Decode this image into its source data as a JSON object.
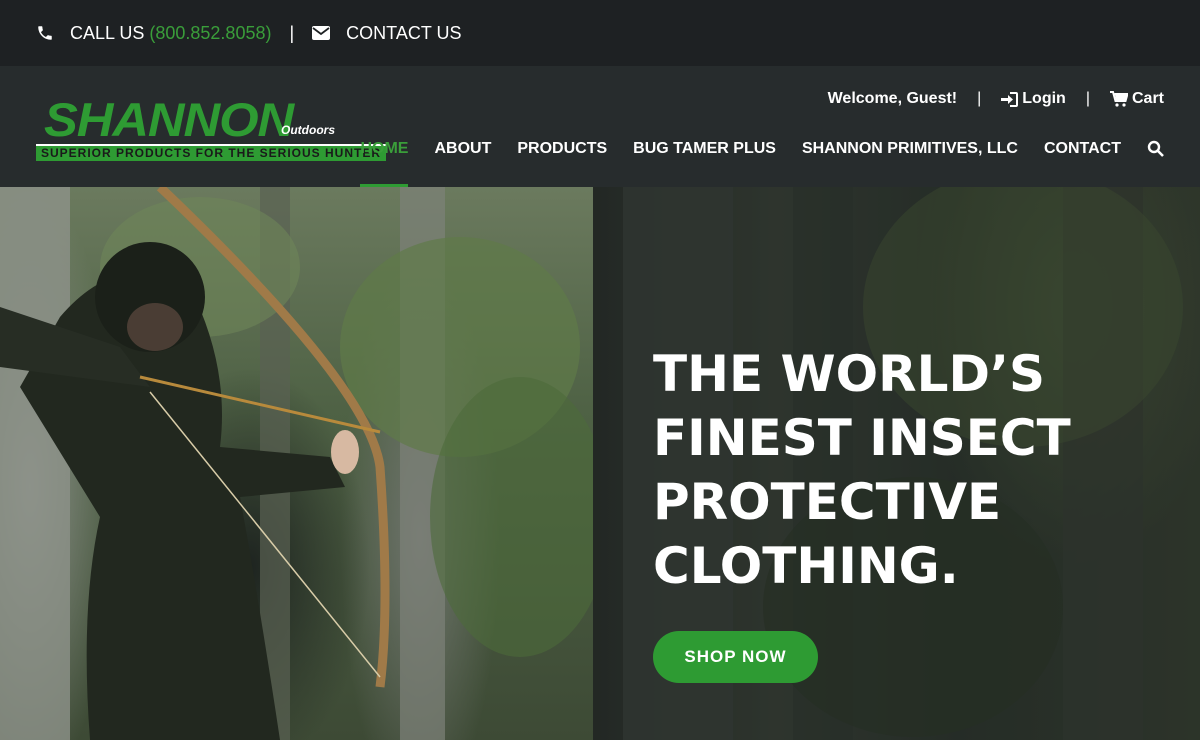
{
  "topbar": {
    "call_label": "CALL US",
    "phone": "(800.852.8058)",
    "separator": "|",
    "contact_label": "CONTACT US"
  },
  "logo": {
    "name": "SHANNON",
    "sub": "Outdoors",
    "tagline": "SUPERIOR PRODUCTS FOR THE SERIOUS HUNTER"
  },
  "account": {
    "welcome": "Welcome, Guest!",
    "separator": "|",
    "login": "Login",
    "cart": "Cart"
  },
  "nav": {
    "items": [
      {
        "label": "HOME",
        "active": true
      },
      {
        "label": "ABOUT"
      },
      {
        "label": "PRODUCTS"
      },
      {
        "label": "BUG TAMER PLUS"
      },
      {
        "label": "SHANNON PRIMITIVES, LLC"
      },
      {
        "label": "CONTACT"
      }
    ]
  },
  "hero": {
    "headline_lines": [
      "THE WORLD’S",
      "FINEST INSECT",
      "PROTECTIVE",
      "CLOTHING."
    ],
    "cta": "SHOP NOW"
  },
  "colors": {
    "accent": "#2e9b33",
    "topbar_bg": "#1e2123",
    "header_bg": "#272c2d"
  },
  "icons": [
    "phone-icon",
    "envelope-icon",
    "login-icon",
    "cart-icon",
    "search-icon"
  ]
}
